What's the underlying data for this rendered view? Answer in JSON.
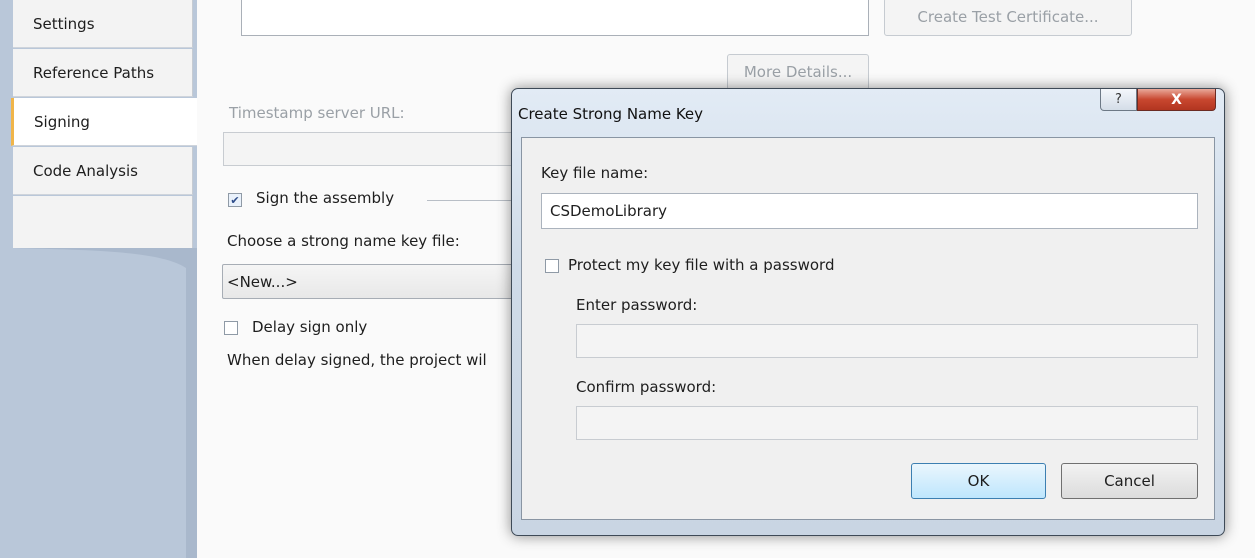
{
  "tabs": [
    {
      "label": "Settings",
      "active": false
    },
    {
      "label": "Reference Paths",
      "active": false
    },
    {
      "label": "Signing",
      "active": true
    },
    {
      "label": "Code Analysis",
      "active": false
    }
  ],
  "signing": {
    "create_test_certificate_label": "Create Test Certificate...",
    "more_details_label": "More Details...",
    "timestamp_label": "Timestamp server URL:",
    "timestamp_value": "",
    "sign_assembly_label": "Sign the assembly",
    "sign_assembly_checked": true,
    "choose_key_label": "Choose a strong name key file:",
    "key_file_selected": "<New...>",
    "delay_sign_label": "Delay sign only",
    "delay_sign_checked": false,
    "delay_note": "When delay signed, the project wil"
  },
  "dialog": {
    "title": "Create Strong Name Key",
    "help_glyph": "?",
    "close_glyph": "X",
    "key_file_name_label": "Key file name:",
    "key_file_name_value": "CSDemoLibrary",
    "protect_label": "Protect my key file with a password",
    "protect_checked": false,
    "enter_password_label": "Enter password:",
    "confirm_password_label": "Confirm password:",
    "ok_label": "OK",
    "cancel_label": "Cancel"
  },
  "colors": {
    "rail": "#b9c7d9",
    "active_tab_accent": "#f0b54a",
    "close_button": "#c8472f",
    "ok_button": "#bee6fd"
  }
}
